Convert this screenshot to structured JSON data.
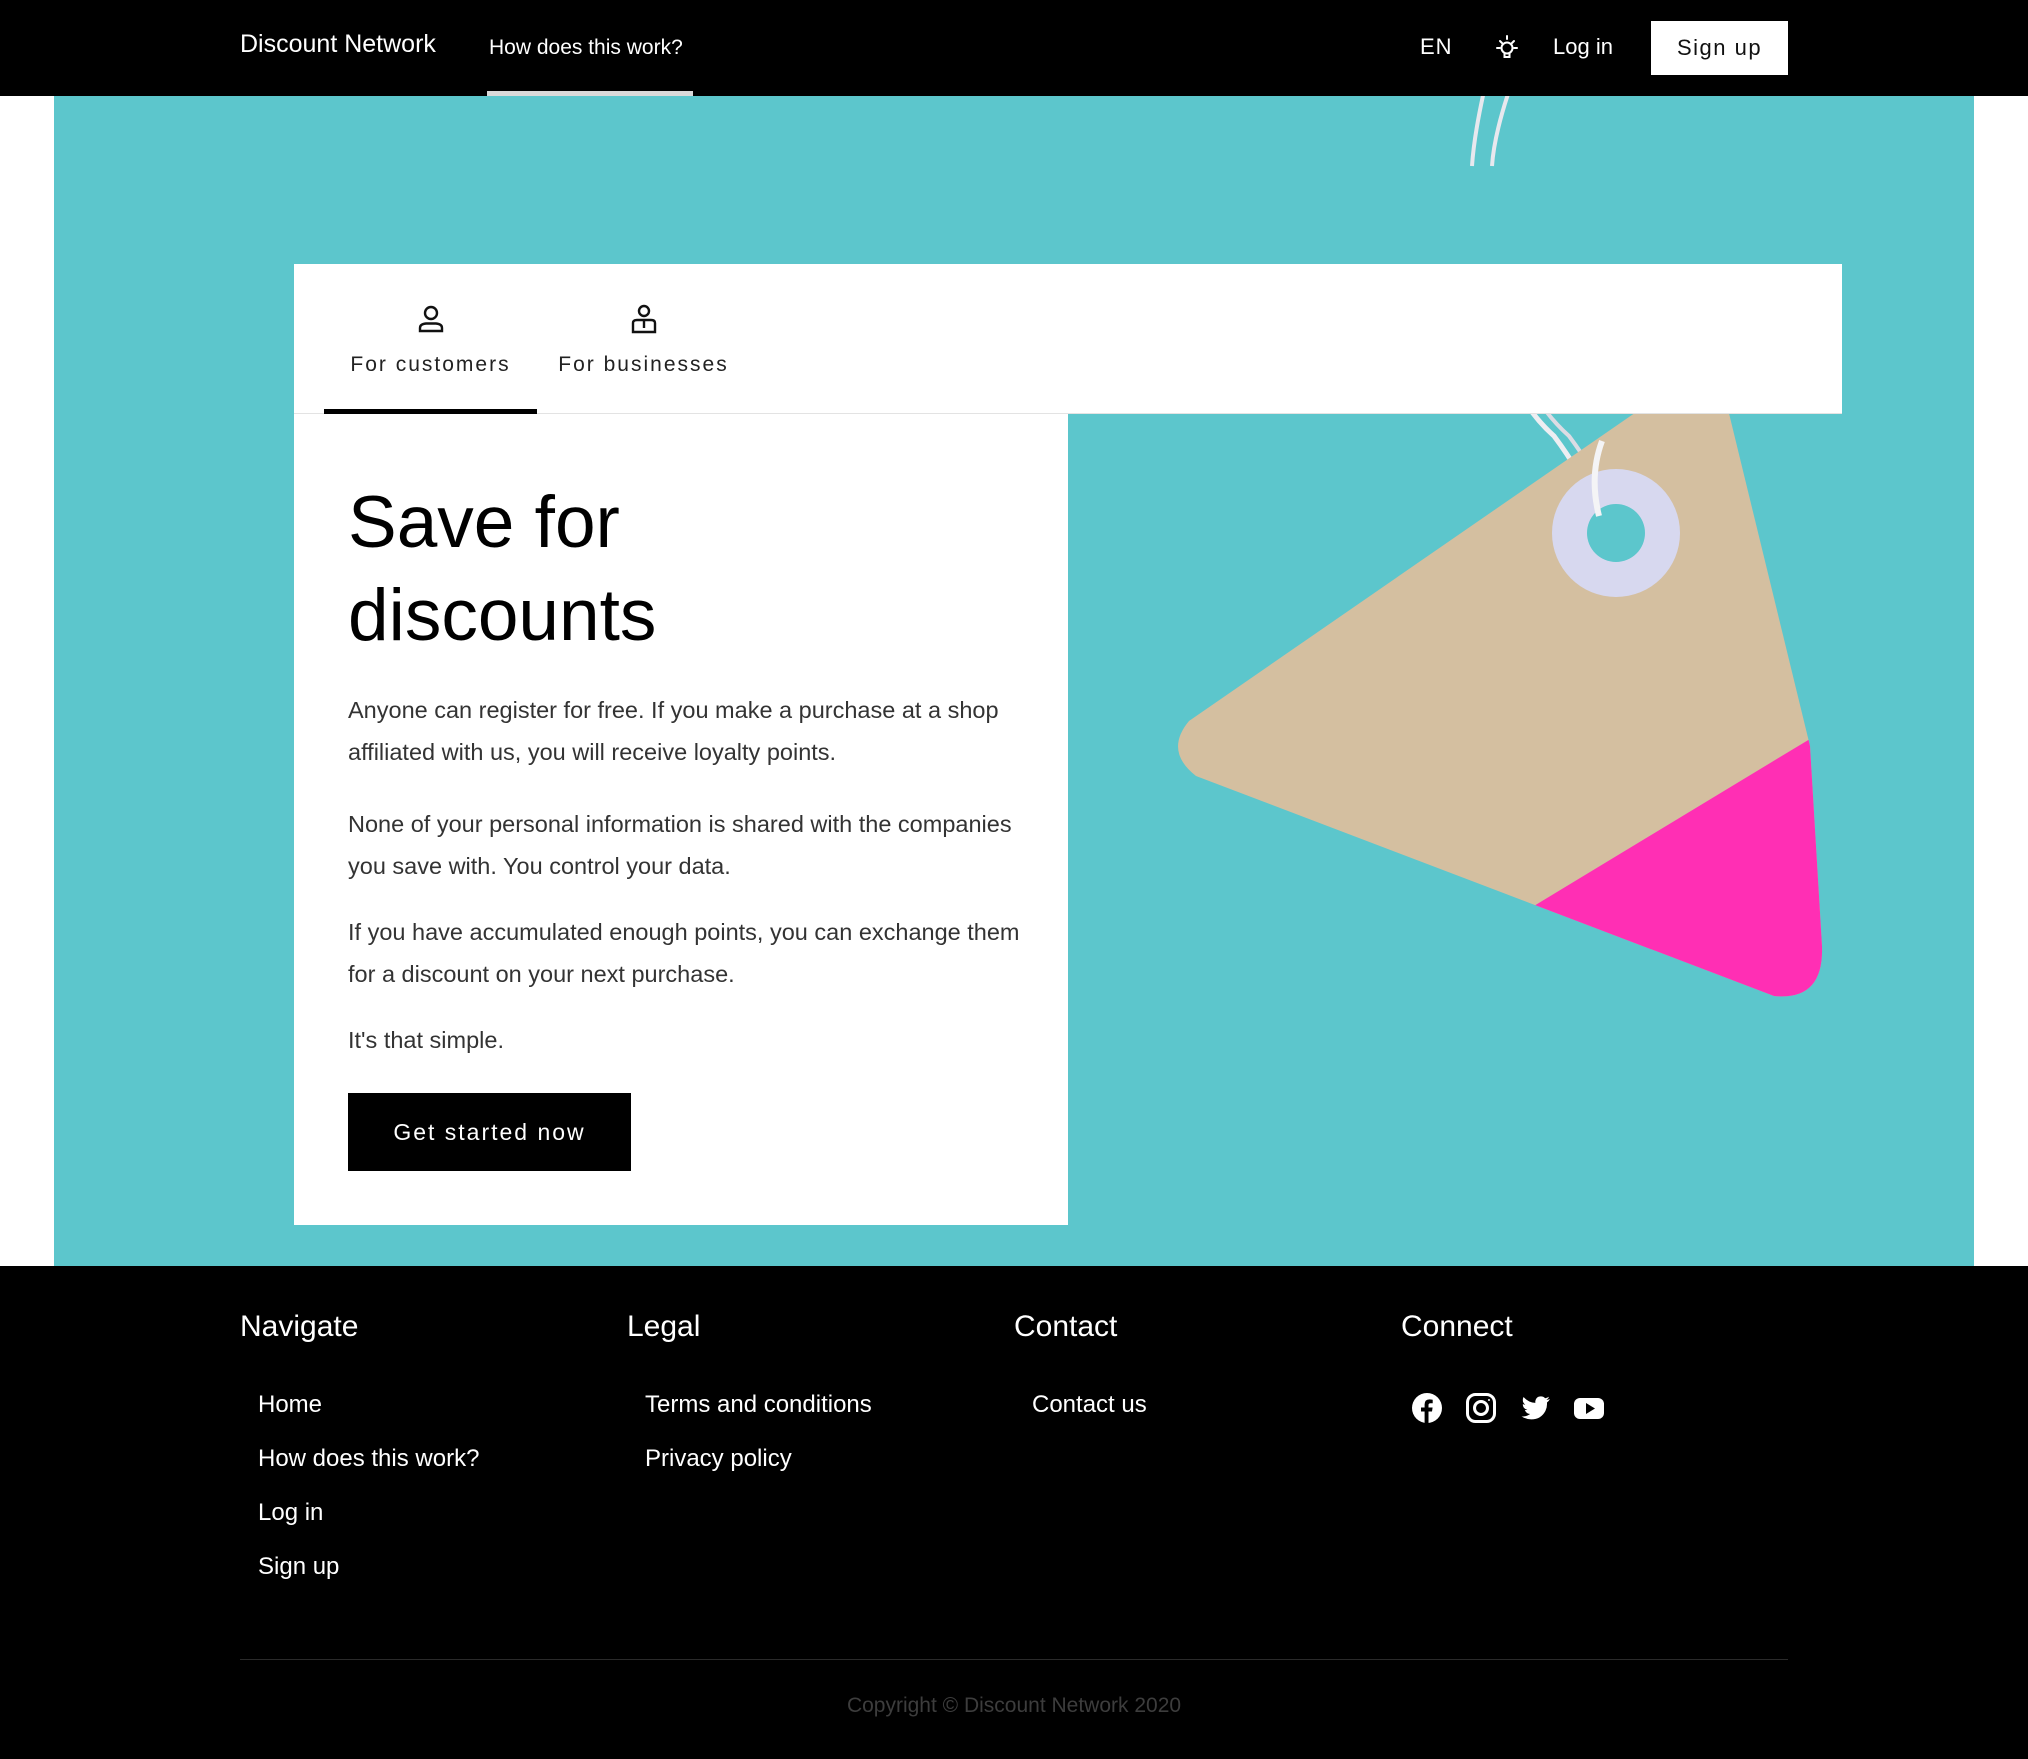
{
  "navbar": {
    "brand": "Discount Network",
    "how_link": "How does this work?",
    "language": "EN",
    "theme_icon": "lightbulb-icon",
    "login": "Log in",
    "signup": "Sign up"
  },
  "tabs": [
    {
      "label": "For customers",
      "icon": "user-icon",
      "active": true
    },
    {
      "label": "For businesses",
      "icon": "business-user-icon",
      "active": false
    }
  ],
  "hero": {
    "headline_line1": "Save for",
    "headline_line2": "discounts",
    "paragraphs": [
      "Anyone can register for free. If you make a purchase at a shop affiliated with us, you will receive loyalty points.",
      "None of your personal information is shared with the companies you save with. You control your data.",
      "If you have accumulated enough points, you can exchange them for a discount on your next purchase.",
      "It's that simple."
    ],
    "cta": "Get started now",
    "colors": {
      "background": "#5cc6cc",
      "tag": "#d4bfa0",
      "tag_accent": "#ff2fb4"
    }
  },
  "footer": {
    "navigate": {
      "title": "Navigate",
      "links": [
        "Home",
        "How does this work?",
        "Log in",
        "Sign up"
      ]
    },
    "legal": {
      "title": "Legal",
      "links": [
        "Terms and conditions",
        "Privacy policy"
      ]
    },
    "contact": {
      "title": "Contact",
      "links": [
        "Contact us"
      ]
    },
    "connect": {
      "title": "Connect",
      "icons": [
        "facebook-icon",
        "instagram-icon",
        "twitter-icon",
        "youtube-icon"
      ]
    },
    "copyright": "Copyright © Discount Network 2020"
  }
}
